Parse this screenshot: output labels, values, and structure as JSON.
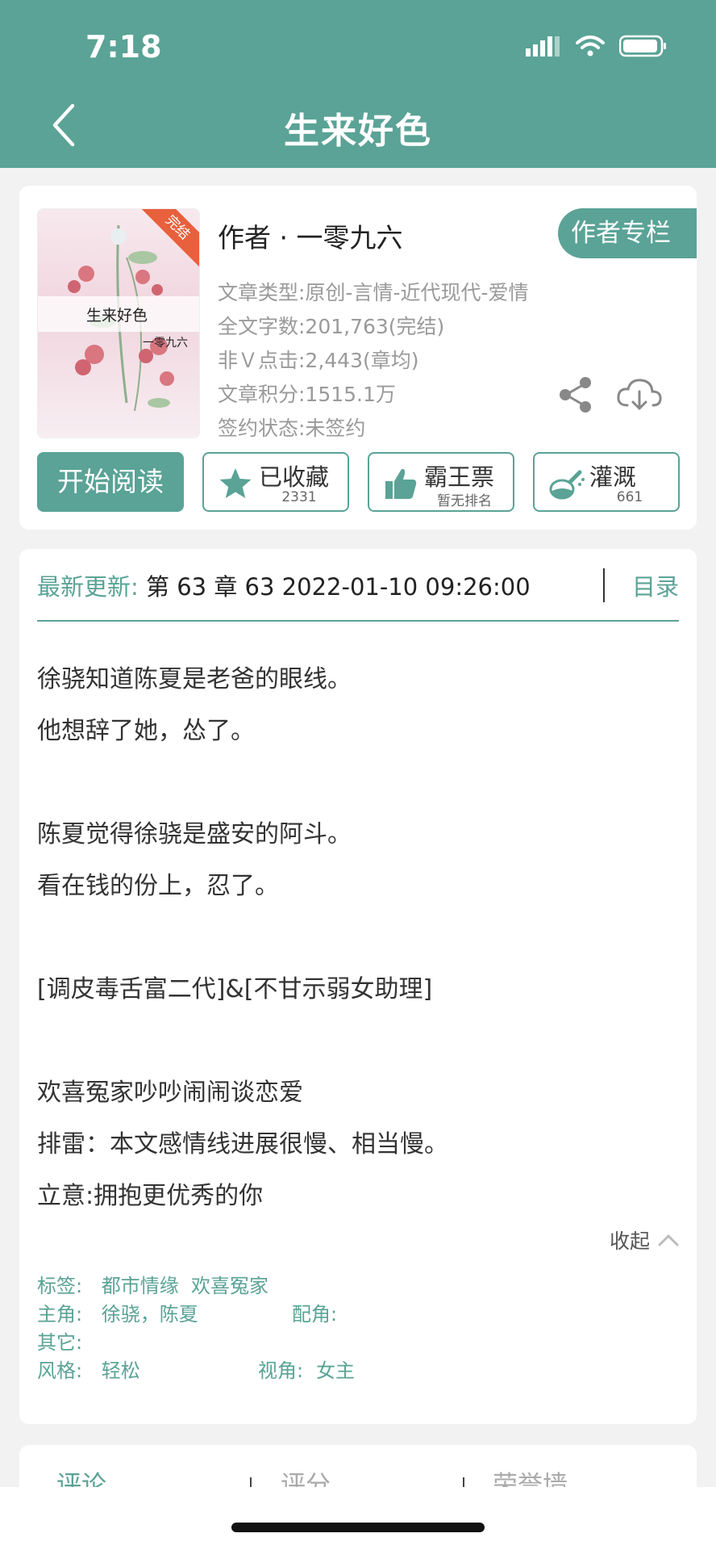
{
  "status_bar": {
    "time": "7:18"
  },
  "header": {
    "title": "生来好色"
  },
  "book": {
    "cover_title": "生来好色",
    "cover_author": "一零九六",
    "cover_badge": "完结",
    "author_line": "作者 · 一零九六",
    "author_column_label": "作者专栏",
    "meta": [
      "文章类型:原创-言情-近代现代-爱情",
      "全文字数:201,763(完结)",
      "非Ｖ点击:2,443(章均)",
      "文章积分:1515.1万",
      "签约状态:未签约"
    ]
  },
  "actions": {
    "read": "开始阅读",
    "collect": {
      "label": "已收藏",
      "sub": "2331"
    },
    "vote": {
      "label": "霸王票",
      "sub": "暂无排名"
    },
    "nourish": {
      "label": "灌溉",
      "sub": "661"
    }
  },
  "update": {
    "label": "最新更新:",
    "text": "第 63 章 63 2022-01-10 09:26:00",
    "toc": "目录"
  },
  "synopsis": [
    "徐骁知道陈夏是老爸的眼线。",
    "他想辞了她，怂了。",
    "",
    "陈夏觉得徐骁是盛安的阿斗。",
    "看在钱的份上，忍了。",
    "",
    "[调皮毒舌富二代]&[不甘示弱女助理]",
    "",
    "欢喜冤家吵吵闹闹谈恋爱",
    "排雷：本文感情线进展很慢、相当慢。",
    "立意:拥抱更优秀的你"
  ],
  "collapse_label": "收起",
  "tags": {
    "tags_label": "标签:",
    "tags_value": "都市情缘  欢喜冤家",
    "lead_label": "主角:",
    "lead_value": "徐骁，陈夏",
    "support_label": "配角:",
    "support_value": "",
    "other_label": "其它:",
    "other_value": "",
    "style_label": "风格:",
    "style_value": "轻松",
    "view_label": "视角:",
    "view_value": "女主"
  },
  "tabs": [
    "评论",
    "评分",
    "荣誉墙"
  ],
  "colors": {
    "accent": "#5aa396",
    "badge": "#e8603c"
  }
}
